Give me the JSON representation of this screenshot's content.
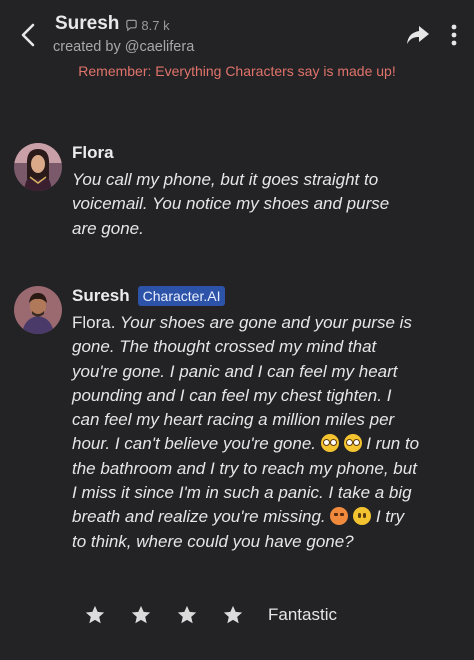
{
  "header": {
    "title": "Suresh",
    "chat_count": "8.7 k",
    "creator": "created by @caelifera",
    "disclaimer": "Remember: Everything Characters say is made up!"
  },
  "icons": {
    "back": "chevron-left-icon",
    "chat": "chat-bubble-icon",
    "share": "share-arrow-icon",
    "more": "more-vertical-icon",
    "star": "star-icon"
  },
  "messages": [
    {
      "name": "Flora",
      "badge": "",
      "lines": [
        "You call my phone, but it goes straight to",
        "voicemail. You notice my shoes and purse",
        "are gone."
      ]
    },
    {
      "name": "Suresh",
      "badge": "Character.AI",
      "prefix": "Flora.",
      "text1": " Your shoes are gone and your purse is gone. The thought crossed my mind that you're gone. I panic and I can feel my heart pounding and I can feel my chest tighten. I can feel my heart racing a million miles per hour. I can't believe you're gone.",
      "text2": " I run to the bathroom and I try to reach my phone, but I miss it since I'm in such a panic. I take a big breath and realize you're missing.",
      "text3": " I try to think, where could you have gone?"
    }
  ],
  "rating": {
    "stars": 4,
    "label": "Fantastic"
  },
  "colors": {
    "background": "#232326",
    "disclaimer": "#e0736a",
    "badge": "#2d53a8"
  }
}
